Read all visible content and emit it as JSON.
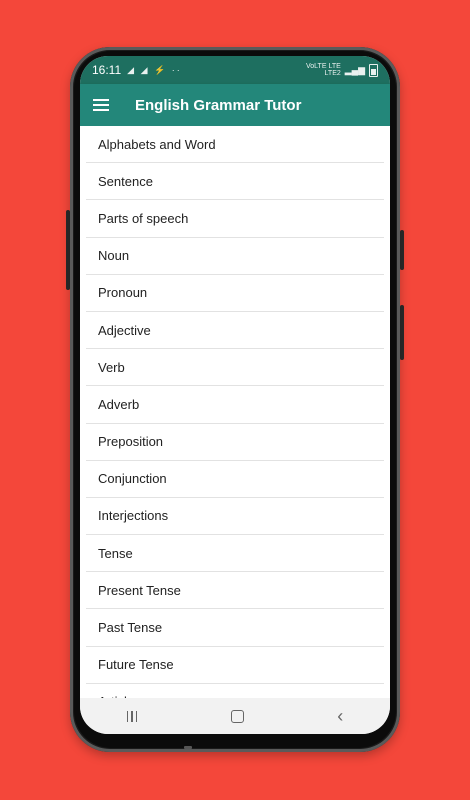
{
  "status_bar": {
    "time": "16:11",
    "left_icons": "◢ ◢ ⚡ ··",
    "network_line1": "VoLTE LTE",
    "network_line2": "LTE2"
  },
  "app_bar": {
    "menu_icon": "hamburger-menu-icon",
    "title": "English Grammar Tutor"
  },
  "topics": [
    "Alphabets and Word",
    "Sentence",
    "Parts of speech",
    "Noun",
    "Pronoun",
    "Adjective",
    "Verb",
    "Adverb",
    "Preposition",
    "Conjunction",
    "Interjections",
    "Tense",
    "Present Tense",
    "Past Tense",
    "Future Tense",
    "Articles"
  ],
  "colors": {
    "background": "#f4473a",
    "app_bar": "#23877a",
    "status_bar": "#1e6f60"
  },
  "nav_bar": {
    "recents_icon": "recents-icon",
    "home_icon": "home-icon",
    "back_icon": "back-icon"
  }
}
